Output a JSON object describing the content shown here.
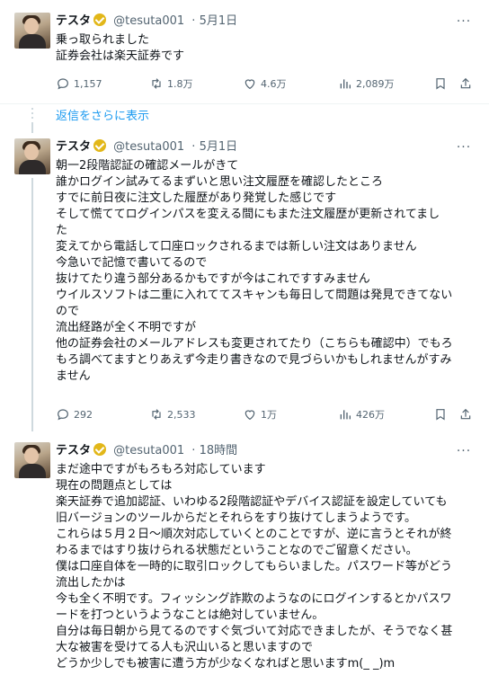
{
  "tweets": [
    {
      "author": "テスタ",
      "handle": "@tesuta001",
      "time": "5月1日",
      "lines": [
        "乗っ取られました",
        "証券会社は楽天証券です"
      ],
      "replies": "1,157",
      "retweets": "1.8万",
      "likes": "4.6万",
      "views": "2,089万"
    },
    {
      "author": "テスタ",
      "handle": "@tesuta001",
      "time": "5月1日",
      "lines": [
        "朝一2段階認証の確認メールがきて",
        "誰かログイン試みてるまずいと思い注文履歴を確認したところ",
        "すでに前日夜に注文した履歴があり発覚した感じです",
        "そして慌ててログインパスを変える間にもまた注文履歴が更新されてまし",
        "た",
        "変えてから電話して口座ロックされるまでは新しい注文はありません",
        "今急いで記憶で書いてるので",
        "抜けてたり違う部分あるかもですが今はこれですすみません",
        "ウイルスソフトは二重に入れててスキャンも毎日して問題は発見できてない",
        "ので",
        "流出経路が全く不明ですが",
        "他の証券会社のメールアドレスも変更されてたり（こちらも確認中）でもろ",
        "もろ調べてますとりあえず今走り書きなので見づらいかもしれませんがすみ",
        "ません"
      ],
      "replies": "292",
      "retweets": "2,533",
      "likes": "1万",
      "views": "426万"
    },
    {
      "author": "テスタ",
      "handle": "@tesuta001",
      "time": "18時間",
      "lines": [
        "まだ途中ですがもろもろ対応しています",
        "現在の問題点としては",
        "楽天証券で追加認証、いわゆる2段階認証やデバイス認証を設定していても",
        "旧バージョンのツールからだとそれらをすり抜けてしまうようです。",
        "これらは５月２日～順次対応していくとのことですが、逆に言うとそれが終",
        "わるまではすり抜けられる状態だということなのでご留意ください。",
        "僕は口座自体を一時的に取引ロックしてもらいました。パスワード等がどう",
        "流出したかは",
        "今も全く不明です。フィッシング詐欺のようなのにログインするとかパスワ",
        "ードを打つというようなことは絶対していません。",
        "自分は毎日朝から見てるのですぐ気づいて対応できましたが、そうでなく甚",
        "大な被害を受けてる人も沢山いると思いますので",
        "どうか少しでも被害に遭う方が少なくなればと思いますm(_ _)m"
      ]
    }
  ],
  "show_more_replies": "返信をさらに表示",
  "more_glyph": "···",
  "colors": {
    "accent": "#1d9bf0",
    "verified": "#e2b719",
    "muted": "#536471"
  }
}
